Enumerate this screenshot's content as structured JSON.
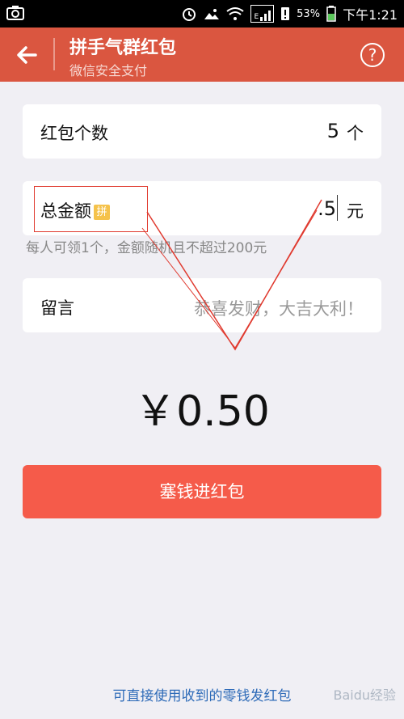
{
  "status_bar": {
    "battery": "53%",
    "time": "下午1:21",
    "network": "E"
  },
  "header": {
    "title": "拼手气群红包",
    "subtitle": "微信安全支付",
    "help": "?"
  },
  "count_row": {
    "label": "红包个数",
    "value": "5",
    "unit": "个"
  },
  "amount_row": {
    "label": "总金额",
    "badge": "拼",
    "value": ".5",
    "unit": "元"
  },
  "hint": "每人可领1个，金额随机且不超过200元",
  "message_row": {
    "label": "留言",
    "placeholder": "恭喜发财，大吉大利！"
  },
  "total_display": "￥0.50",
  "submit_button": "塞钱进红包",
  "footer_link": "可直接使用收到的零钱发红包",
  "watermark": "Baidu经验",
  "colors": {
    "header": "#da5640",
    "button": "#f55b4a",
    "link": "#2e6bb8",
    "annotation": "#e03a2f"
  }
}
